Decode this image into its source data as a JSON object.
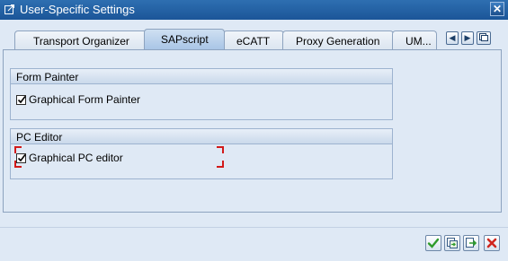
{
  "window": {
    "title": "User-Specific Settings"
  },
  "tabs": [
    {
      "label": "Transport Organizer",
      "active": false
    },
    {
      "label": "SAPscript",
      "active": true
    },
    {
      "label": "eCATT",
      "active": false
    },
    {
      "label": "Proxy Generation",
      "active": false
    },
    {
      "label": "UM...",
      "active": false
    }
  ],
  "groups": {
    "form_painter": {
      "title": "Form Painter",
      "option": {
        "label": "Graphical Form Painter",
        "checked": true
      }
    },
    "pc_editor": {
      "title": "PC Editor",
      "option": {
        "label": "Graphical PC editor",
        "checked": true
      }
    }
  },
  "icons": {
    "window": "settings-window-icon",
    "close": "close-icon",
    "tab_prev": "arrow-left-icon",
    "tab_next": "arrow-right-icon",
    "tab_list": "tab-list-icon",
    "confirm": "checkmark-icon",
    "copy": "copy-icon",
    "transfer": "transfer-icon",
    "cancel": "cancel-icon"
  },
  "colors": {
    "title_bar": "#1b5598",
    "background": "#dfe9f5",
    "focus_marker": "#d21a1a"
  }
}
